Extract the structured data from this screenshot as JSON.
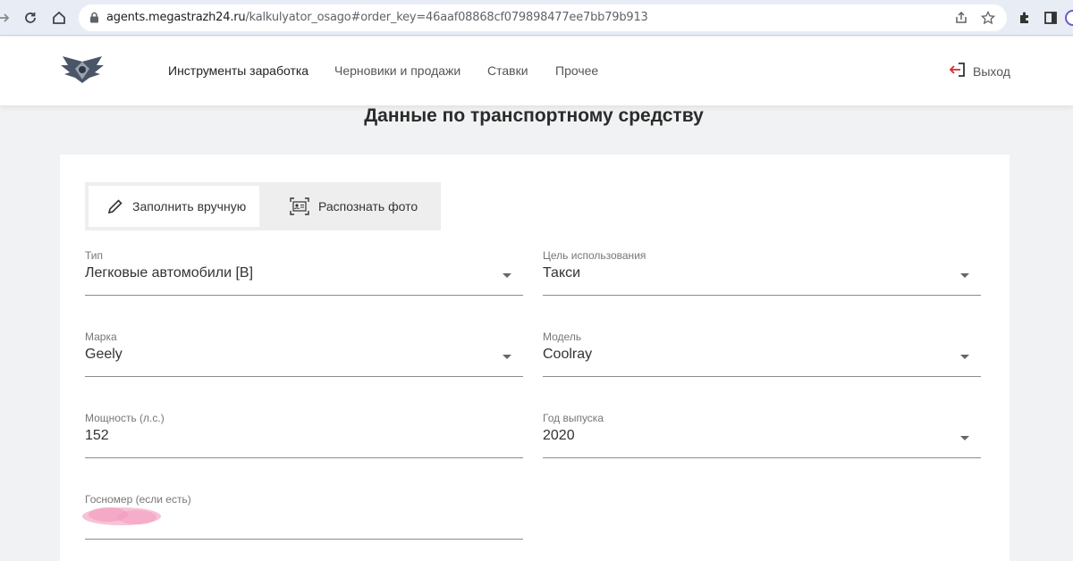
{
  "browser": {
    "url_host": "agents.megastrazh24.ru",
    "url_path": "/kalkulyator_osago#order_key=46aaf08868cf079898477ee7bb79b913"
  },
  "header": {
    "menu": [
      {
        "label": "Инструменты заработка",
        "active": true
      },
      {
        "label": "Черновики и продажи",
        "active": false
      },
      {
        "label": "Ставки",
        "active": false
      },
      {
        "label": "Прочее",
        "active": false
      }
    ],
    "logout_label": "Выход",
    "accent_color": "#d32f2f"
  },
  "page": {
    "title": "Данные по транспортному средству"
  },
  "mode_switch": {
    "manual_label": "Заполнить вручную",
    "photo_label": "Распознать фото",
    "selected": "manual"
  },
  "fields": {
    "type": {
      "label": "Тип",
      "value": "Легковые автомобили [B]"
    },
    "purpose": {
      "label": "Цель использования",
      "value": "Такси"
    },
    "brand": {
      "label": "Марка",
      "value": "Geely"
    },
    "model": {
      "label": "Модель",
      "value": "Coolray"
    },
    "power": {
      "label": "Мощность (л.с.)",
      "value": "152"
    },
    "year": {
      "label": "Год выпуска",
      "value": "2020"
    },
    "plate": {
      "label": "Госномер (если есть)",
      "value": ""
    }
  }
}
